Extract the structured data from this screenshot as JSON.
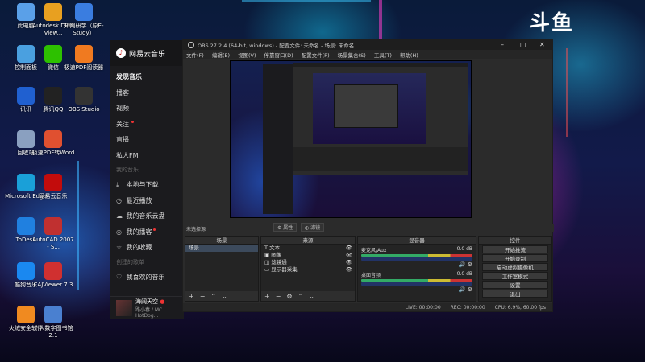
{
  "desktop": {
    "watermark": "斗鱼",
    "icons": [
      {
        "label": "此电脑",
        "icon": "computer-icon",
        "color": "#5aa0e8"
      },
      {
        "label": "Autodesk DWF View...",
        "icon": "autodesk-icon",
        "color": "#e8a020"
      },
      {
        "label": "知网研学（原E-Study）",
        "icon": "estudy-icon",
        "color": "#3a7de0"
      },
      {
        "label": "控制面板",
        "icon": "control-panel-icon",
        "color": "#4aa0e0"
      },
      {
        "label": "微信",
        "icon": "wechat-icon",
        "color": "#2dc100"
      },
      {
        "label": "极速PDF阅读器",
        "icon": "pdf-reader-icon",
        "color": "#f07a20"
      },
      {
        "label": "讯讯",
        "icon": "xunxun-icon",
        "color": "#2060d0"
      },
      {
        "label": "腾讯QQ",
        "icon": "qq-icon",
        "color": "#222"
      },
      {
        "label": "OBS Studio",
        "icon": "obs-icon",
        "color": "#333"
      },
      {
        "label": "回收站",
        "icon": "recycle-bin-icon",
        "color": "#8aa0c0"
      },
      {
        "label": "极速PDF转Word",
        "icon": "pdf-word-icon",
        "color": "#e05030"
      },
      {
        "label": "Microsoft Edge",
        "icon": "edge-icon",
        "color": "#1aa0d8"
      },
      {
        "label": "网易云音乐",
        "icon": "netease-music-icon",
        "color": "#c20c0c"
      },
      {
        "label": "ToDesk",
        "icon": "todesk-icon",
        "color": "#2080e0"
      },
      {
        "label": "AutoCAD 2007 - S...",
        "icon": "autocad-icon",
        "color": "#c03030"
      },
      {
        "label": "酷狗音乐",
        "icon": "kugou-icon",
        "color": "#1a88f0"
      },
      {
        "label": "CAJViewer 7.3",
        "icon": "cajviewer-icon",
        "color": "#d03030"
      },
      {
        "label": "火绒安全软件",
        "icon": "huorong-icon",
        "color": "#f08a20"
      },
      {
        "label": "个人数字图书馆2.1",
        "icon": "digital-library-icon",
        "color": "#4a80d0"
      }
    ]
  },
  "music": {
    "app_title": "网易云音乐",
    "nav": [
      "发现音乐",
      "播客",
      "视频",
      "关注",
      "直播",
      "私人FM"
    ],
    "section_mine": "我的音乐",
    "mine": [
      {
        "label": "本地与下载",
        "icon": "download-icon"
      },
      {
        "label": "最近播放",
        "icon": "clock-icon"
      },
      {
        "label": "我的音乐云盘",
        "icon": "cloud-icon"
      },
      {
        "label": "我的播客",
        "icon": "podcast-icon"
      },
      {
        "label": "我的收藏",
        "icon": "star-icon"
      }
    ],
    "section_created": "创建的歌单",
    "playlist_liked": "我喜欢的音乐",
    "now_playing_title": "海阔天空",
    "now_playing_artist": "路小春 / MC HotDog..."
  },
  "obs": {
    "window_title": "OBS 27.2.4 (64-bit, windows) - 配置文件: 未命名 - 场景: 未命名",
    "menu": [
      "文件(F)",
      "编辑(E)",
      "视图(V)",
      "停靠窗口(D)",
      "配置文件(P)",
      "场景集合(S)",
      "工具(T)",
      "帮助(H)"
    ],
    "no_source": "未选择源",
    "props_btn": "属性",
    "filters_btn": "滤镜",
    "docks": {
      "scenes": "场景",
      "sources": "来源",
      "mixer": "混音器",
      "controls": "控件"
    },
    "scenes": [
      "场景"
    ],
    "sources": [
      {
        "label": "文本",
        "icon": "text-icon"
      },
      {
        "label": "图像",
        "icon": "image-icon"
      },
      {
        "label": "滤镜通",
        "icon": "filter-icon"
      },
      {
        "label": "显示器采集",
        "icon": "monitor-icon"
      }
    ],
    "mixer": [
      {
        "label": "麦克风/Aux",
        "db": "0.0 dB"
      },
      {
        "label": "桌面音频",
        "db": "0.0 dB"
      }
    ],
    "controls": [
      "开始推流",
      "开始录制",
      "启动虚拟摄像机",
      "工作室模式",
      "设置",
      "退出"
    ],
    "status": {
      "live": "LIVE: 00:00:00",
      "rec": "REC: 00:00:00",
      "cpu": "CPU: 6.9%, 60.00 fps"
    }
  }
}
